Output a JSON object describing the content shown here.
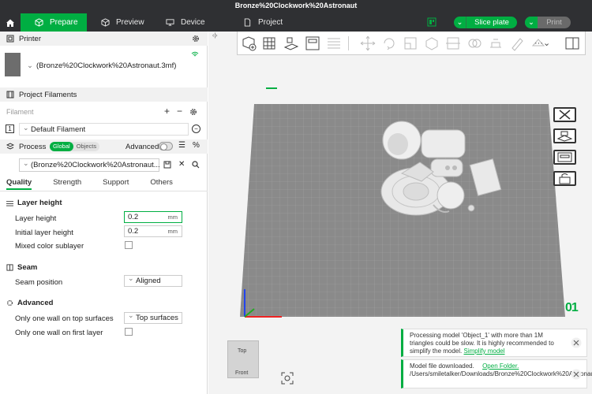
{
  "window": {
    "title": "Bronze%20Clockwork%20Astronaut"
  },
  "tabs": [
    {
      "label": "Prepare",
      "icon": "cube-icon",
      "active": true
    },
    {
      "label": "Preview",
      "icon": "eye-cube-icon",
      "active": false
    },
    {
      "label": "Device",
      "icon": "monitor-icon",
      "active": false
    },
    {
      "label": "Project",
      "icon": "document-icon",
      "active": false
    }
  ],
  "actions": {
    "slice_label": "Slice plate",
    "print_label": "Print"
  },
  "colors": {
    "accent": "#00ae42",
    "topbar": "#2f3033",
    "plate": "#8a8a8a"
  },
  "printer": {
    "header": "Printer",
    "name": "(Bronze%20Clockwork%20Astronaut.3mf)"
  },
  "filaments": {
    "header": "Project Filaments",
    "label": "Filament",
    "items": [
      {
        "index": "1",
        "name": "Default Filament"
      }
    ]
  },
  "process": {
    "label": "Process",
    "mode_global": "Global",
    "mode_objects": "Objects",
    "advanced_label": "Advanced",
    "advanced_on": false,
    "profile": "(Bronze%20Clockwork%20Astronaut...",
    "tabs": [
      "Quality",
      "Strength",
      "Support",
      "Others"
    ],
    "active_tab": "Quality"
  },
  "settings": {
    "layer_height": {
      "title": "Layer height",
      "layer_height_label": "Layer height",
      "layer_height_value": "0.2",
      "layer_height_unit": "mm",
      "initial_layer_label": "Initial layer height",
      "initial_layer_value": "0.2",
      "initial_layer_unit": "mm",
      "mixed_color_label": "Mixed color sublayer"
    },
    "seam": {
      "title": "Seam",
      "position_label": "Seam position",
      "position_value": "Aligned"
    },
    "advanced": {
      "title": "Advanced",
      "one_wall_top_label": "Only one wall on top surfaces",
      "one_wall_top_value": "Top surfaces",
      "one_wall_first_label": "Only one wall on first layer"
    }
  },
  "viewport": {
    "plate_number": "01",
    "viewcube_top": "Top",
    "viewcube_front": "Front"
  },
  "notifications": [
    {
      "text": "Processing model 'Object_1' with more than 1M triangles could be slow. It is highly recommended to simplify the model.",
      "link": "Simplify model"
    },
    {
      "text_prefix": "Model file downloaded.",
      "link": "Open Folder.",
      "path": "/Users/smiletalker/Downloads/Bronze%20Clockwork%20Astronaut.3mf"
    }
  ]
}
